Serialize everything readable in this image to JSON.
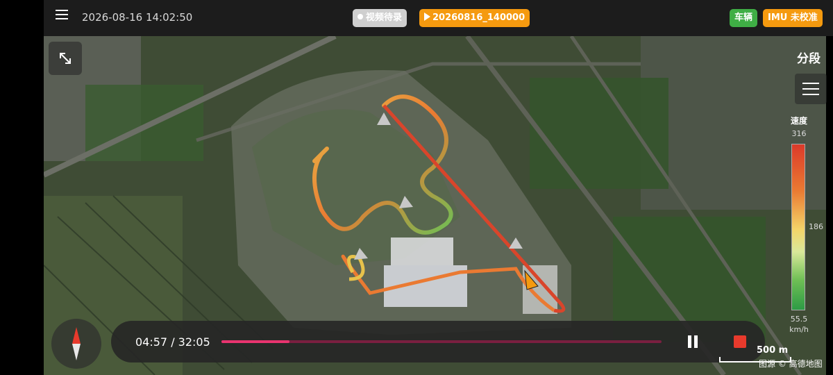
{
  "header": {
    "datetime": "2026-08-16 14:02:50",
    "video_status": "视频待录",
    "recording_name": "20260816_140000",
    "vehicle_label": "车辆",
    "imu_label": "IMU 未校准"
  },
  "map": {
    "segment_label": "分段",
    "scale_text": "500 m",
    "attribution": "图源 © 高德地图"
  },
  "legend": {
    "title": "速度",
    "max": "316",
    "mid": "186",
    "min": "55.5",
    "unit": "km/h"
  },
  "playback": {
    "time": "04:57 / 32:05",
    "progress_percent": 15.4
  },
  "colors": {
    "progress": "#e8346f",
    "stop": "#e83a2c",
    "badge_orange": "#f59a0f",
    "badge_green": "#3fae45"
  },
  "icons": [
    "menu-icon",
    "expand-icon",
    "list-icon",
    "compass-icon",
    "pause-icon",
    "stop-icon",
    "car-position-icon"
  ]
}
